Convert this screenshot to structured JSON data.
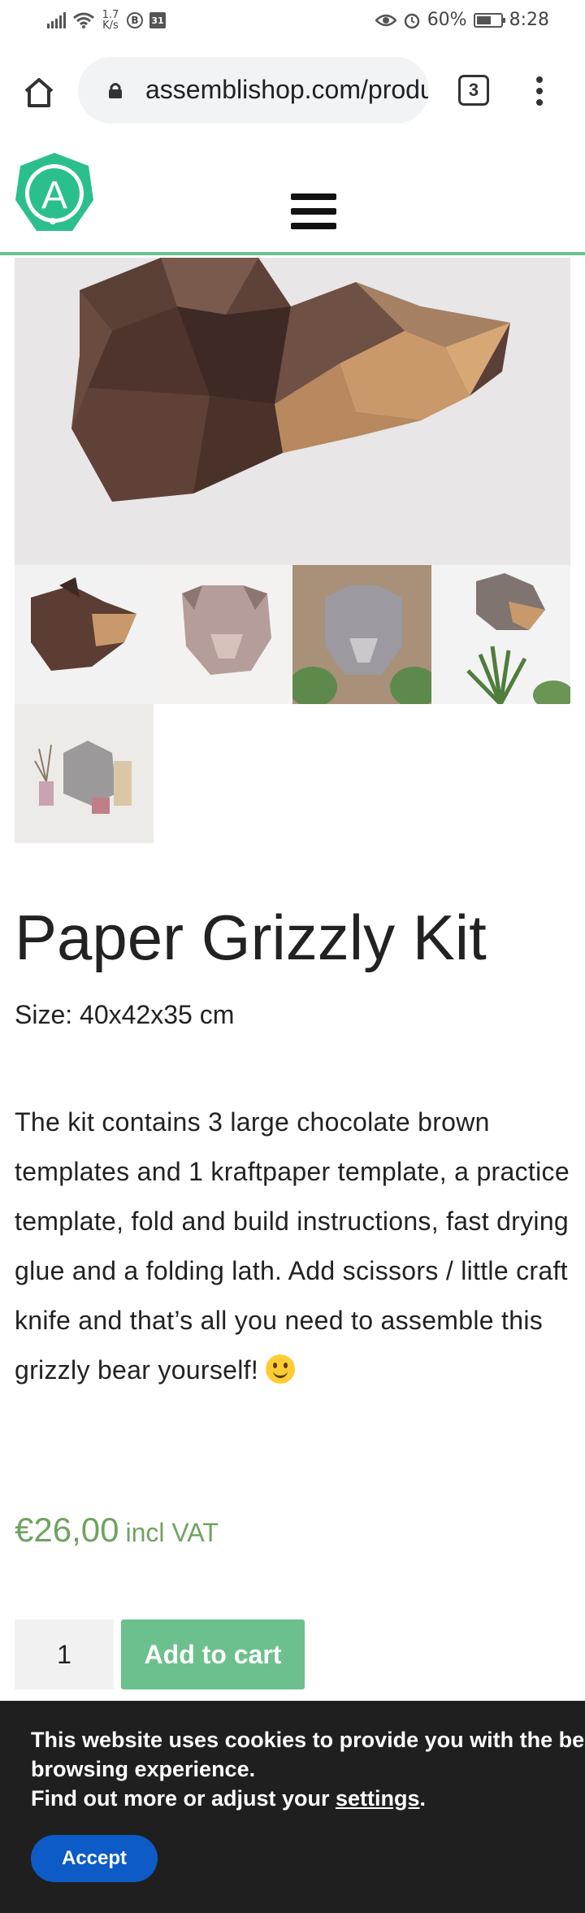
{
  "status_bar": {
    "net_speed_value": "1.7",
    "net_speed_unit": "K/s",
    "chip_b": "B",
    "calendar_day": "31",
    "battery_percent": "60%",
    "battery_level": 0.6,
    "time": "8:28"
  },
  "browser": {
    "url": "assemblishop.com/product",
    "tab_count": "3"
  },
  "site": {
    "logo_letter": "A"
  },
  "gallery": {
    "main_image": "paper-bear-head-brown",
    "thumbnails": [
      "paper-bear-brown",
      "paper-bear-pink",
      "paper-bear-grey-plants",
      "paper-bear-grey-room",
      "paper-bear-grey-shelf"
    ]
  },
  "product": {
    "title": "Paper Grizzly Kit",
    "size": "Size: 40x42x35 cm",
    "description": "The kit contains 3 large chocolate brown templates and 1 kraftpaper template, a practice template,  fold and build instructions, fast drying glue and a folding lath. Add scissors / little craft knife and that’s all you need to assemble this grizzly bear yourself!",
    "price": "€26,00",
    "vat_label": "incl VAT",
    "quantity": "1",
    "add_to_cart_label": "Add to cart"
  },
  "cookie": {
    "line1": "This website uses cookies to provide you with the best",
    "line2": "browsing experience.",
    "line3_prefix": "Find out more or adjust your ",
    "settings_link": "settings",
    "line3_suffix": ".",
    "accept_label": "Accept"
  },
  "colors": {
    "accent_green": "#6cc08e",
    "price_green": "#6fa35f",
    "cookie_bg": "#1f1f1f",
    "accept_blue": "#0d5bc6"
  }
}
